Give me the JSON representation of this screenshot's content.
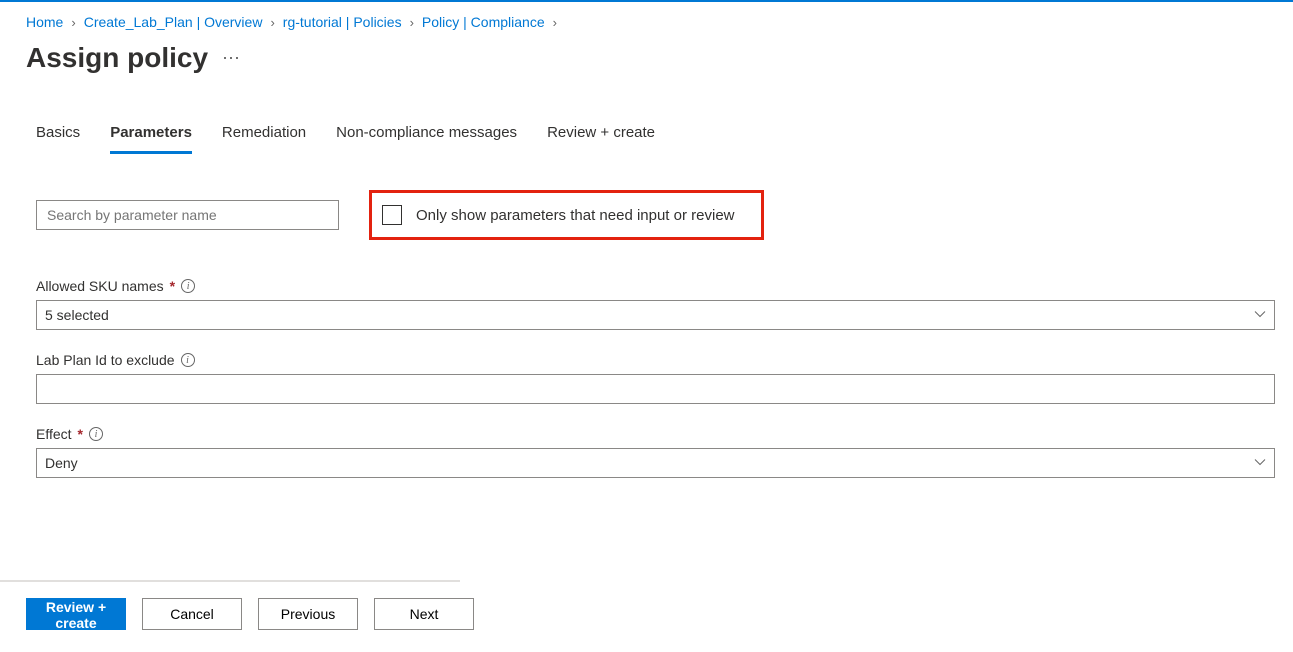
{
  "breadcrumb": {
    "items": [
      {
        "label": "Home"
      },
      {
        "label": "Create_Lab_Plan | Overview"
      },
      {
        "label": "rg-tutorial | Policies"
      },
      {
        "label": "Policy | Compliance"
      }
    ]
  },
  "page": {
    "title": "Assign policy"
  },
  "tabs": [
    {
      "label": "Basics",
      "active": false
    },
    {
      "label": "Parameters",
      "active": true
    },
    {
      "label": "Remediation",
      "active": false
    },
    {
      "label": "Non-compliance messages",
      "active": false
    },
    {
      "label": "Review + create",
      "active": false
    }
  ],
  "search": {
    "placeholder": "Search by parameter name",
    "value": ""
  },
  "filter_checkbox": {
    "label": "Only show parameters that need input or review",
    "checked": false
  },
  "fields": {
    "allowed_sku": {
      "label": "Allowed SKU names",
      "required": true,
      "value": "5 selected"
    },
    "lab_plan_exclude": {
      "label": "Lab Plan Id to exclude",
      "required": false,
      "value": ""
    },
    "effect": {
      "label": "Effect",
      "required": true,
      "value": "Deny"
    }
  },
  "footer": {
    "review": "Review + create",
    "cancel": "Cancel",
    "previous": "Previous",
    "next": "Next"
  }
}
